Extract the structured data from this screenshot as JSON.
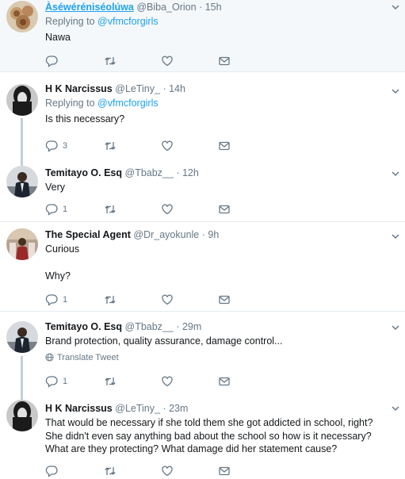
{
  "replying_prefix": "Replying to",
  "tweets": [
    {
      "name": "Àséwéréniséolúwa",
      "handle": "@Biba_Orion",
      "sep": "·",
      "time": "15h",
      "replying_to": "@vfmcforgirls",
      "text": [
        "Nawa"
      ],
      "counts": {
        "reply": "",
        "retweet": "",
        "like": ""
      }
    },
    {
      "name": "H K Narcissus",
      "handle": "@LeTiny_",
      "sep": "·",
      "time": "14h",
      "replying_to": "@vfmcforgirls",
      "text": [
        "Is this necessary?"
      ],
      "counts": {
        "reply": "3",
        "retweet": "",
        "like": ""
      }
    },
    {
      "name": "Temitayo O. Esq",
      "handle": "@Tbabz__",
      "sep": "·",
      "time": "12h",
      "text": [
        "Very"
      ],
      "counts": {
        "reply": "1",
        "retweet": "",
        "like": ""
      }
    },
    {
      "name": "The Special Agent",
      "handle": "@Dr_ayokunle",
      "sep": "·",
      "time": "9h",
      "text": [
        "Curious",
        "Why?"
      ],
      "counts": {
        "reply": "1",
        "retweet": "",
        "like": ""
      }
    },
    {
      "name": "Temitayo O. Esq",
      "handle": "@Tbabz__",
      "sep": "·",
      "time": "29m",
      "text": [
        "Brand protection, quality assurance, damage control..."
      ],
      "translate": "Translate Tweet",
      "counts": {
        "reply": "1",
        "retweet": "",
        "like": ""
      }
    },
    {
      "name": "H K Narcissus",
      "handle": "@LeTiny_",
      "sep": "·",
      "time": "23m",
      "text": [
        "That would be necessary if she told them she  got addicted in school, right? She didn't even say anything bad about the school so how is it necessary? What are they protecting? What damage did her statement cause?"
      ],
      "counts": {
        "reply": "",
        "retweet": "",
        "like": ""
      }
    }
  ],
  "colors": {
    "link": "#1da1f2",
    "muted": "#657786",
    "thread_line": "#c4cfd6",
    "highlight_bg": "#f5f8fa"
  },
  "icons": [
    "reply-icon",
    "retweet-icon",
    "like-icon",
    "message-icon",
    "chevron-down-icon",
    "globe-icon"
  ]
}
